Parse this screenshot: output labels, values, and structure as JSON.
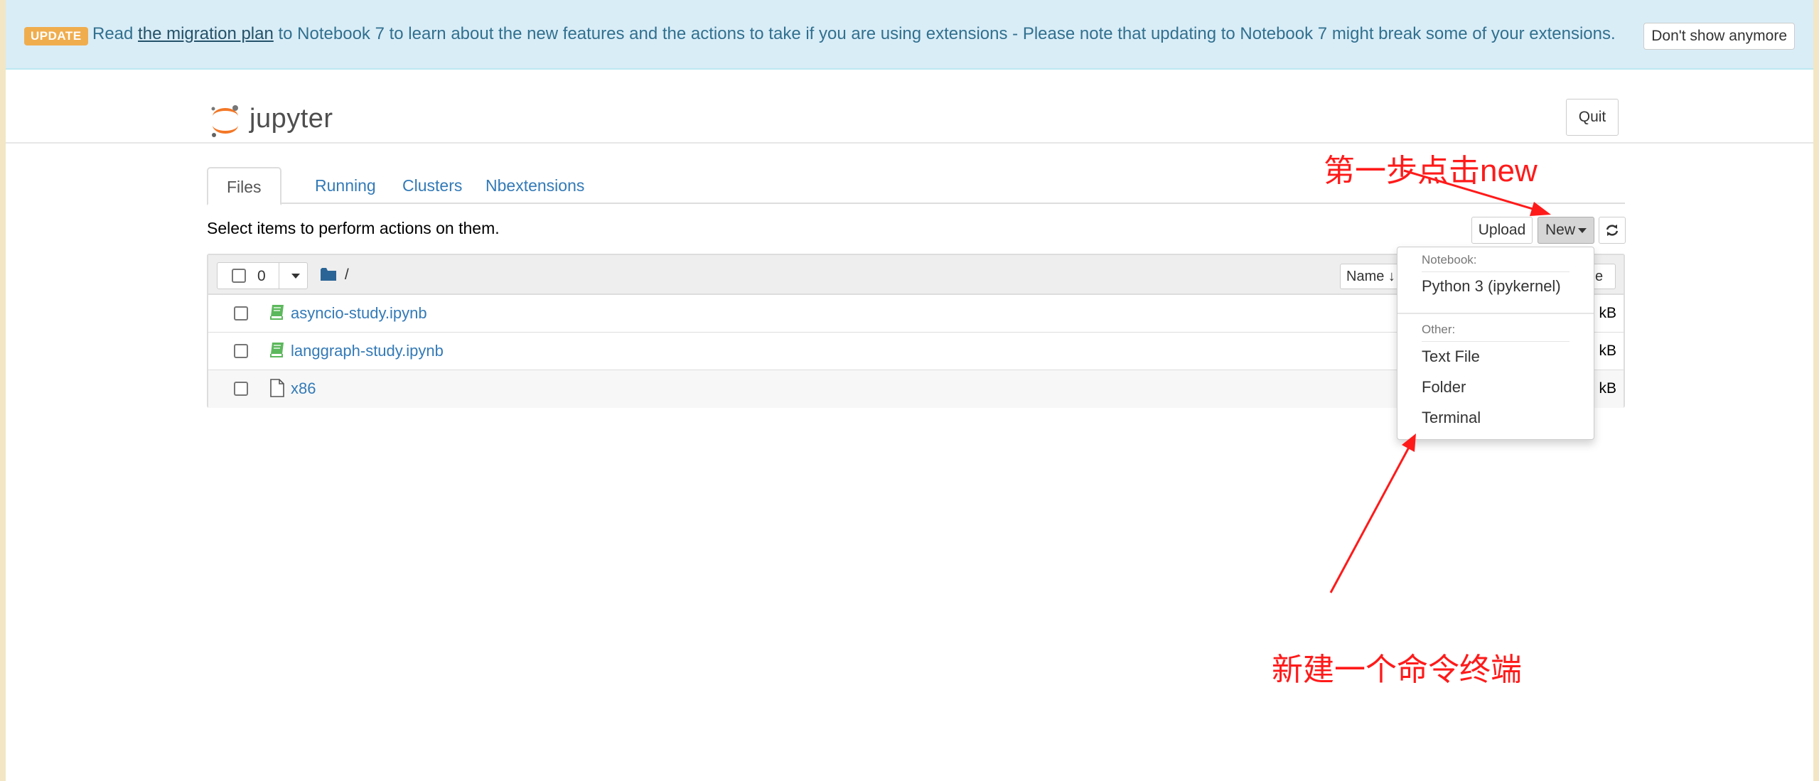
{
  "banner": {
    "badge": "UPDATE",
    "text_before": "Read ",
    "link": "the migration plan",
    "text_after": " to Notebook 7 to learn about the new features and the actions to take if you are using extensions - Please note that updating to Notebook 7 might break some of your extensions.",
    "dismiss_label": "Don't show anymore"
  },
  "header": {
    "logo_text": "jupyter",
    "quit_label": "Quit"
  },
  "tabs": [
    {
      "label": "Files",
      "active": true
    },
    {
      "label": "Running",
      "active": false
    },
    {
      "label": "Clusters",
      "active": false
    },
    {
      "label": "Nbextensions",
      "active": false
    }
  ],
  "toolbar": {
    "hint": "Select items to perform actions on them.",
    "upload_label": "Upload",
    "new_label": "New"
  },
  "list_header": {
    "selected_count": "0",
    "breadcrumb": "/",
    "name_label": "Name",
    "size_label": "ze"
  },
  "files": [
    {
      "name": "asyncio-study.ipynb",
      "type": "notebook",
      "size": "kB"
    },
    {
      "name": "langgraph-study.ipynb",
      "type": "notebook",
      "size": "kB"
    },
    {
      "name": "x86",
      "type": "file",
      "size": "kB"
    }
  ],
  "new_menu": {
    "notebook_header": "Notebook:",
    "notebook_items": [
      "Python 3 (ipykernel)"
    ],
    "other_header": "Other:",
    "other_items": [
      "Text File",
      "Folder",
      "Terminal"
    ]
  },
  "annotations": {
    "step1": "第一步点击new",
    "step2": "新建一个命令终端",
    "color": "#ff1a1a"
  },
  "colors": {
    "banner_bg": "#d9edf7",
    "badge": "#f0ad4e",
    "link": "#337ab7"
  }
}
